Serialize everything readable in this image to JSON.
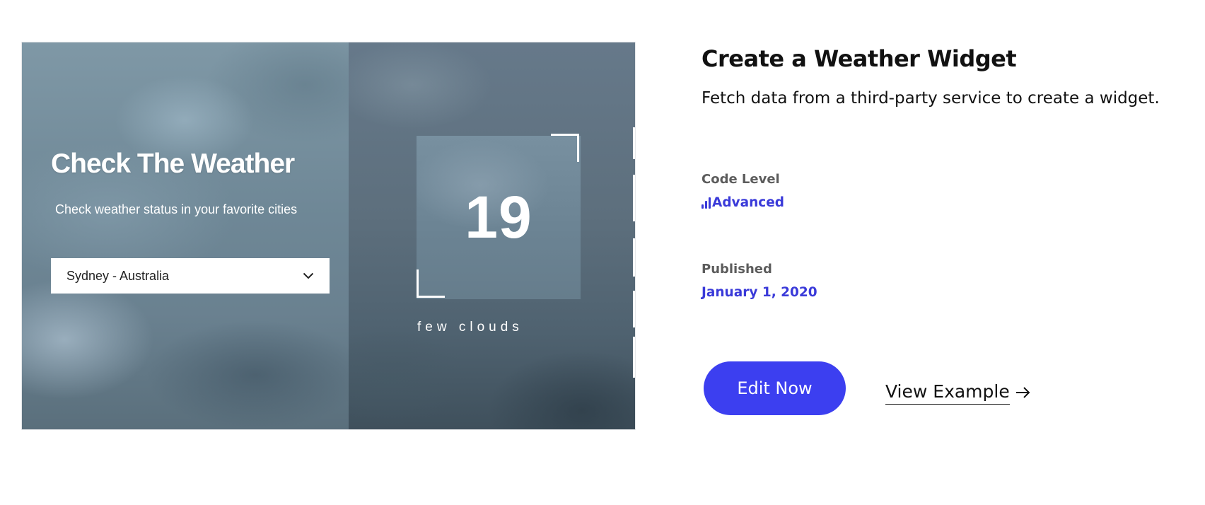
{
  "preview": {
    "widget_title": "Check The Weather",
    "widget_subtitle": "Check weather status in your favorite cities",
    "city_select": {
      "selected": "Sydney - Australia",
      "icon": "chevron-down-icon"
    },
    "temperature": "19",
    "condition": "few clouds"
  },
  "info": {
    "title": "Create a Weather Widget",
    "description": "Fetch data from a third-party service to create a widget.",
    "code_level": {
      "label": "Code Level",
      "value": "Advanced",
      "icon": "signal-bars-icon"
    },
    "published": {
      "label": "Published",
      "value": "January 1, 2020"
    },
    "actions": {
      "edit_label": "Edit Now",
      "view_label": "View Example",
      "view_icon": "arrow-right-icon"
    }
  },
  "colors": {
    "accent": "#3c3ff0",
    "accent_text": "#3a3ad9",
    "text_primary": "#111111",
    "text_muted": "#5c5c5c"
  }
}
